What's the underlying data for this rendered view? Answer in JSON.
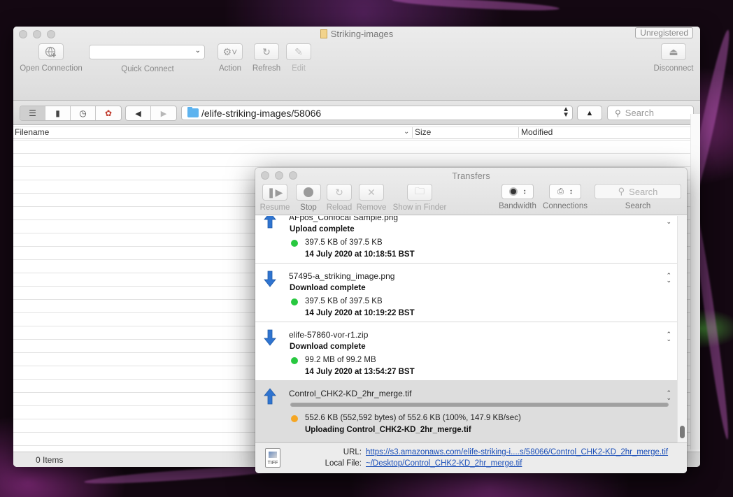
{
  "main_window": {
    "title": "Striking-images",
    "unregistered_label": "Unregistered",
    "toolbar": {
      "open_connection": "Open Connection",
      "quick_connect": "Quick Connect",
      "action": "Action",
      "refresh": "Refresh",
      "edit": "Edit",
      "disconnect": "Disconnect"
    },
    "path": "/elife-striking-images/58066",
    "search_placeholder": "Search",
    "columns": {
      "filename": "Filename",
      "size": "Size",
      "modified": "Modified"
    },
    "status": "0 Items"
  },
  "transfers_window": {
    "title": "Transfers",
    "toolbar": {
      "resume": "Resume",
      "stop": "Stop",
      "reload": "Reload",
      "remove": "Remove",
      "show_in_finder": "Show in Finder",
      "bandwidth": "Bandwidth",
      "connections": "Connections",
      "search": "Search",
      "search_placeholder": "Search"
    },
    "items": [
      {
        "direction": "upload",
        "name": "AFpos_Confocal Sample.png",
        "status": "Upload complete",
        "size": "397.5 KB of 397.5 KB",
        "date": "14 July 2020 at 10:18:51 BST"
      },
      {
        "direction": "download",
        "name": "57495-a_striking_image.png",
        "status": "Download complete",
        "size": "397.5 KB of 397.5 KB",
        "date": "14 July 2020 at 10:19:22 BST"
      },
      {
        "direction": "download",
        "name": "elife-57860-vor-r1.zip",
        "status": "Download complete",
        "size": "99.2 MB of 99.2 MB",
        "date": "14 July 2020 at 13:54:27 BST"
      },
      {
        "direction": "upload",
        "name": "Control_CHK2-KD_2hr_merge.tif",
        "size": "552.6 KB (552,592 bytes) of 552.6 KB (100%, 147.9 KB/sec)",
        "status": "Uploading Control_CHK2-KD_2hr_merge.tif",
        "progress_percent": 100
      }
    ],
    "footer": {
      "url_label": "URL:",
      "url_value": "https://s3.amazonaws.com/elife-striking-i....s/58066/Control_CHK2-KD_2hr_merge.tif",
      "local_label": "Local File:",
      "local_value": "~/Desktop/Control_CHK2-KD_2hr_merge.tif",
      "file_icon_text": "TIFF"
    },
    "colors": {
      "complete_dot": "#28c840",
      "active_dot": "#f5a623",
      "arrow_blue": "#2f74d0"
    }
  }
}
